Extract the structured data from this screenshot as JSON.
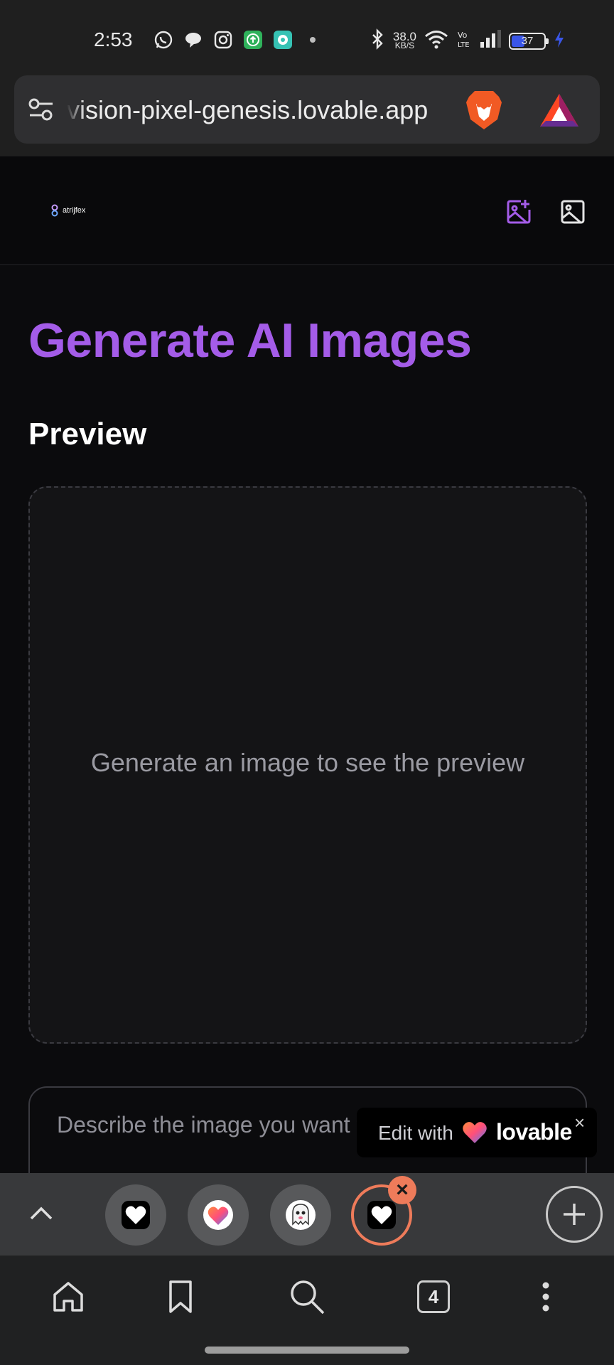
{
  "status_bar": {
    "time": "2:53",
    "app_icons": [
      "whatsapp-icon",
      "chat-bubble-icon",
      "instagram-icon",
      "upload-app-icon",
      "chat-app-icon",
      "dot-icon"
    ],
    "net_speed_value": "38.0",
    "net_speed_unit": "KB/S",
    "battery_level": "37",
    "battery_percent": 37,
    "charging": true
  },
  "browser": {
    "url": "vision-pixel-genesis.lovable.app",
    "brave_shield_icon": "brave-lion-icon",
    "rewards_icon": "bat-triangle-icon"
  },
  "app": {
    "logo_text": "atrijfex",
    "header_icons": [
      "image-plus-icon",
      "image-icon"
    ],
    "accent_color": "#a45ce8"
  },
  "main": {
    "title": "Generate AI Images",
    "preview_heading": "Preview",
    "preview_placeholder": "Generate an image to see the preview",
    "prompt_placeholder": "Describe the image you want to generate..."
  },
  "lovable_badge": {
    "edit_label": "Edit with",
    "brand": "lovable",
    "close_label": "×"
  },
  "tab_strip": {
    "tabs": [
      {
        "icon": "heart-favicon-icon",
        "active": false
      },
      {
        "icon": "lovable-heart-icon",
        "active": false
      },
      {
        "icon": "ghost-icon",
        "active": false
      },
      {
        "icon": "heart-favicon-icon",
        "active": true
      }
    ],
    "close_label": "×",
    "add_icon": "plus-circle-icon"
  },
  "bottom_nav": {
    "items": [
      "home-icon",
      "bookmark-icon",
      "search-icon",
      "tabs-icon",
      "more-icon"
    ],
    "tab_count": "4"
  }
}
